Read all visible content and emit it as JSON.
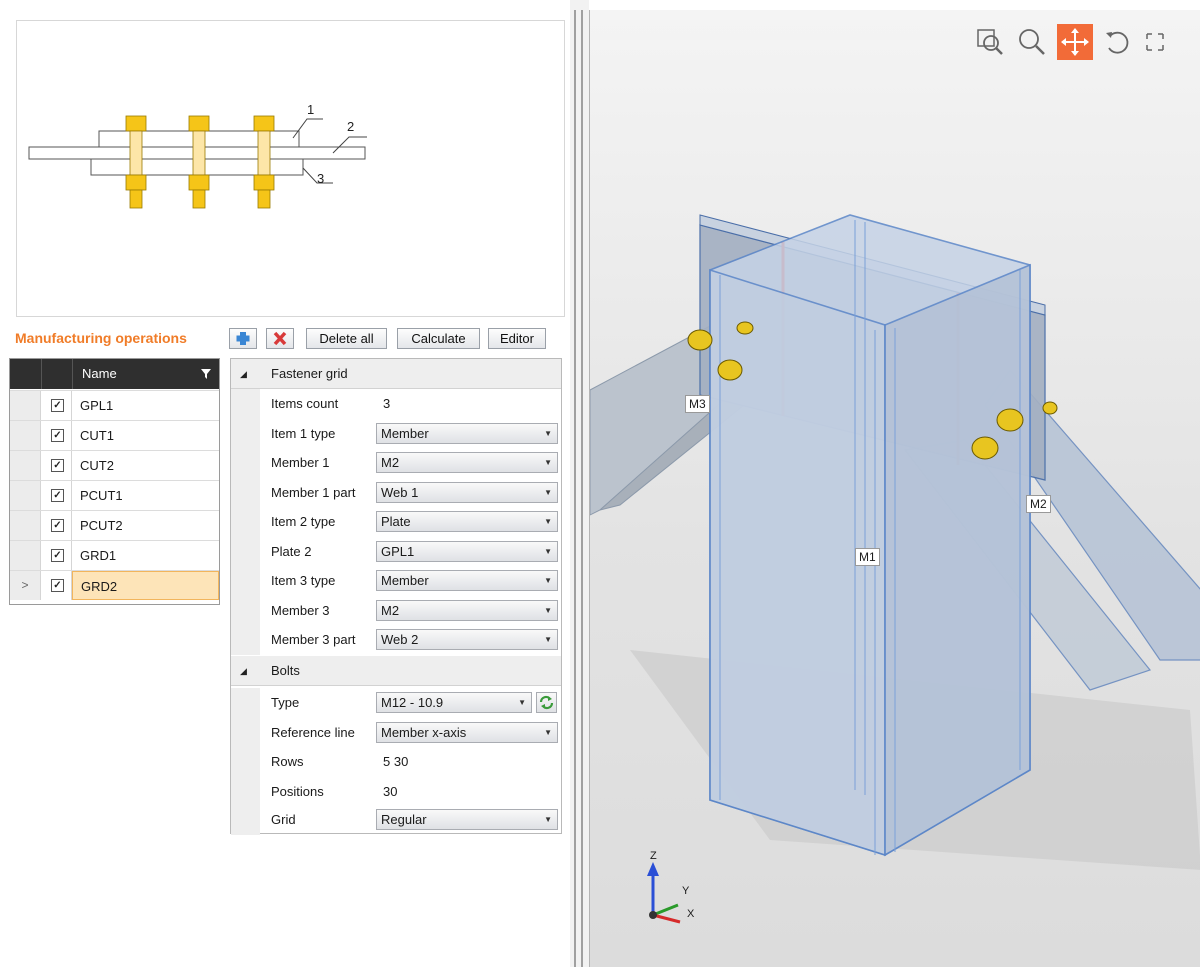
{
  "preview": {
    "labels": [
      "1",
      "2",
      "3"
    ]
  },
  "manufacturing": {
    "title": "Manufacturing operations",
    "toolbar": {
      "add_icon": "plus-icon",
      "delete_icon": "cross-icon",
      "delete_all": "Delete all",
      "calculate": "Calculate",
      "editor": "Editor"
    },
    "table": {
      "column": "Name",
      "rows": [
        {
          "name": "GPL1",
          "checked": true
        },
        {
          "name": "CUT1",
          "checked": true
        },
        {
          "name": "CUT2",
          "checked": true
        },
        {
          "name": "PCUT1",
          "checked": true
        },
        {
          "name": "PCUT2",
          "checked": true
        },
        {
          "name": "GRD1",
          "checked": true
        },
        {
          "name": "GRD2",
          "checked": true,
          "selected": true,
          "indicator": ">"
        }
      ]
    }
  },
  "properties": {
    "fastener_grid": {
      "title": "Fastener grid",
      "items_count_label": "Items count",
      "items_count": "3",
      "item1_type_label": "Item 1 type",
      "item1_type": "Member",
      "member1_label": "Member 1",
      "member1": "M2",
      "member1_part_label": "Member 1 part",
      "member1_part": "Web 1",
      "item2_type_label": "Item 2 type",
      "item2_type": "Plate",
      "plate2_label": "Plate 2",
      "plate2": "GPL1",
      "item3_type_label": "Item 3 type",
      "item3_type": "Member",
      "member3_label": "Member 3",
      "member3": "M2",
      "member3_part_label": "Member 3 part",
      "member3_part": "Web 2"
    },
    "bolts": {
      "title": "Bolts",
      "type_label": "Type",
      "type": "M12 - 10.9",
      "reference_line_label": "Reference line",
      "reference_line": "Member x-axis",
      "rows_label": "Rows",
      "rows": "5 30",
      "positions_label": "Positions",
      "positions": "30",
      "grid_label": "Grid",
      "grid": "Regular"
    }
  },
  "viewport": {
    "tools": [
      "zoom-window-icon",
      "zoom-icon",
      "pan-icon",
      "rotate-icon",
      "fit-icon"
    ],
    "active_tool": "pan-icon",
    "active_color": "#f26b38",
    "members": [
      "M1",
      "M2",
      "M3"
    ],
    "axes": {
      "z": "Z",
      "y": "Y",
      "x": "X"
    }
  }
}
